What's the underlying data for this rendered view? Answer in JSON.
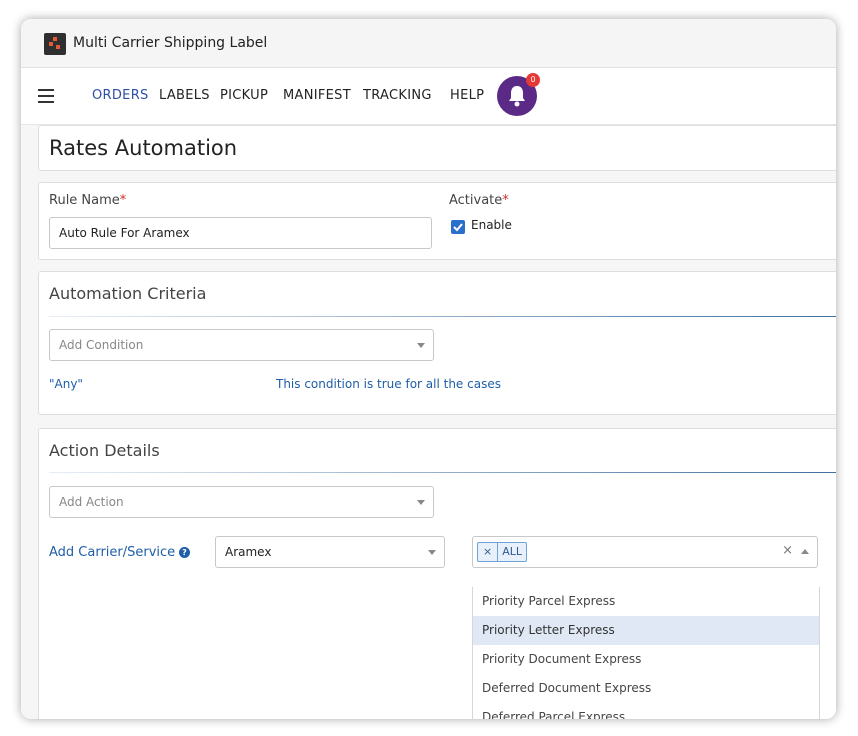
{
  "window": {
    "title": "Multi Carrier Shipping Label"
  },
  "nav": {
    "items": [
      {
        "label": "ORDERS",
        "active": true
      },
      {
        "label": "LABELS"
      },
      {
        "label": "PICKUP"
      },
      {
        "label": "MANIFEST"
      },
      {
        "label": "TRACKING"
      },
      {
        "label": "HELP"
      }
    ],
    "notifications": {
      "icon": "bell-icon",
      "count": "0"
    }
  },
  "page": {
    "title": "Rates Automation"
  },
  "rule": {
    "name_label": "Rule Name",
    "name_value": "Auto Rule For Aramex",
    "activate_label": "Activate",
    "required_mark": "*",
    "enable_label": "Enable",
    "enabled": true
  },
  "criteria": {
    "title": "Automation Criteria",
    "add_placeholder": "Add Condition",
    "condition_name": "\"Any\"",
    "condition_desc": "This condition is true for all the cases"
  },
  "action": {
    "title": "Action Details",
    "add_placeholder": "Add Action",
    "carrier_label": "Add Carrier/Service",
    "help_icon": "question-circle-icon",
    "carrier_value": "Aramex",
    "selected_tag": "ALL",
    "tag_remove": "×",
    "clear": "×",
    "options": [
      "Priority Parcel Express",
      "Priority Letter Express",
      "Priority Document Express",
      "Deferred Document Express",
      "Deferred Parcel Express"
    ],
    "highlighted_option": "Priority Letter Express"
  },
  "colors": {
    "accent": "#2e4fa3",
    "bell_bg": "#5b2a86",
    "badge": "#e53935",
    "link": "#1f5ea8",
    "checkbox": "#2a6fc9"
  }
}
